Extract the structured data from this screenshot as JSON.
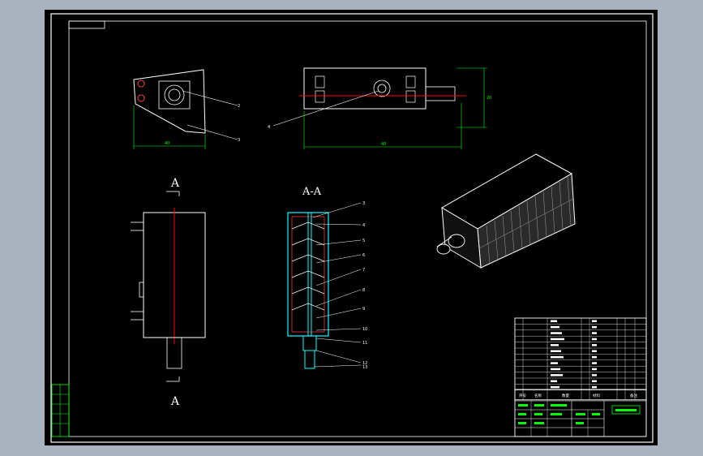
{
  "drawing": {
    "section_labels": {
      "view_a_top": "A",
      "view_a_bottom": "A",
      "section_view": "A-A"
    },
    "dimensions": {
      "side_width": "40",
      "top_length": "40",
      "top_height": "20"
    },
    "balloons_top": [
      "1",
      "2",
      "3",
      "4"
    ],
    "balloons_section": [
      "3",
      "4",
      "5",
      "6",
      "7",
      "8",
      "9",
      "10",
      "11",
      "12",
      "13"
    ]
  },
  "bom": {
    "header": [
      "序号",
      "名称",
      "数量",
      "材料",
      "备注"
    ],
    "row_count": 12
  },
  "title_block": {
    "rows": 5,
    "green_box": ""
  },
  "colors": {
    "background": "#000000",
    "frame": "#ffffff",
    "dimension": "#00ff00",
    "centerline": "#ff0000",
    "section_hatch": "#00ffff",
    "title_green": "#00ff00"
  }
}
